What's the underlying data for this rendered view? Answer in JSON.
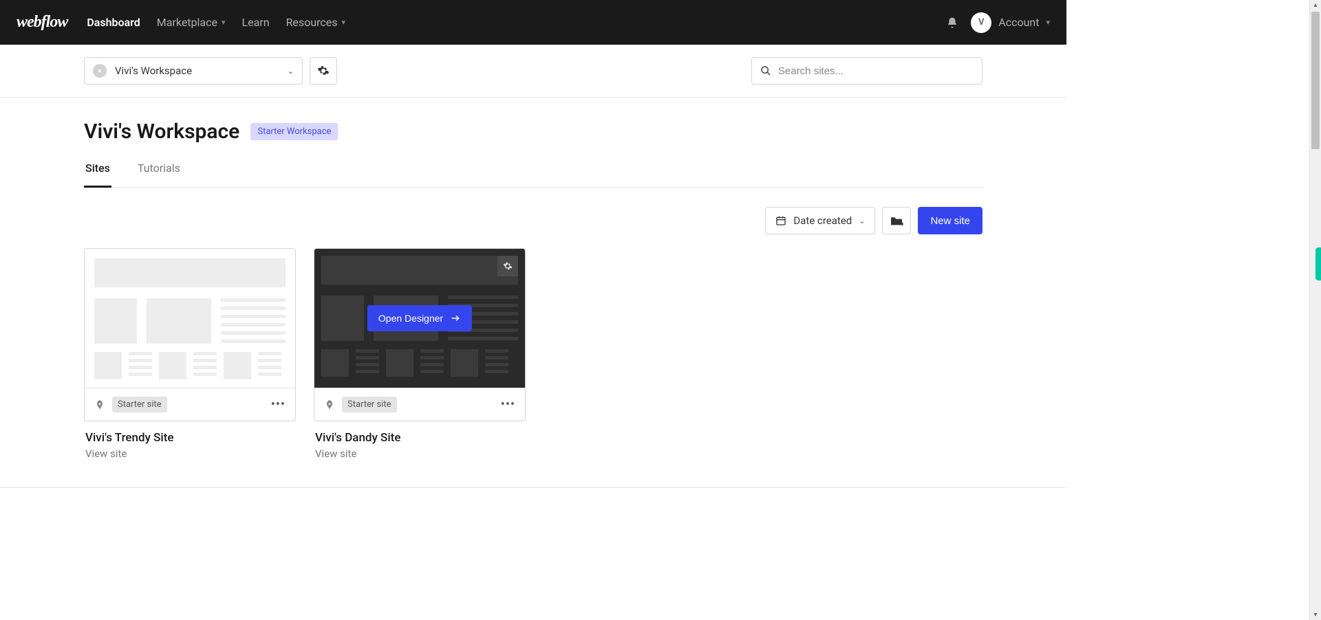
{
  "nav": {
    "logo": "webflow",
    "links": {
      "dashboard": "Dashboard",
      "marketplace": "Marketplace",
      "learn": "Learn",
      "resources": "Resources"
    },
    "account": {
      "avatar_initial": "V",
      "label": "Account"
    }
  },
  "subbar": {
    "workspace_name": "Vivi's Workspace",
    "search_placeholder": "Search sites..."
  },
  "header": {
    "title": "Vivi's Workspace",
    "badge": "Starter Workspace"
  },
  "tabs": {
    "sites": "Sites",
    "tutorials": "Tutorials"
  },
  "toolbar": {
    "sort_label": "Date created",
    "new_site": "New site"
  },
  "sites": [
    {
      "badge": "Starter site",
      "name": "Vivi's Trendy Site",
      "view": "View site"
    },
    {
      "badge": "Starter site",
      "name": "Vivi's Dandy Site",
      "view": "View site",
      "open_designer": "Open Designer"
    }
  ]
}
